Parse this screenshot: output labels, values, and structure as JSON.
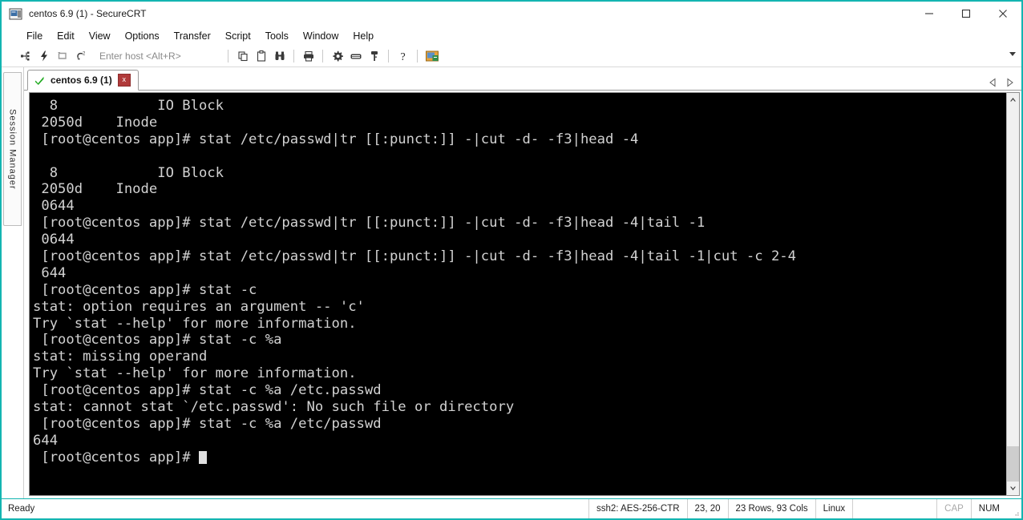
{
  "window": {
    "title": "centos 6.9 (1) - SecureCRT",
    "app_icon": "securecrt-terminal-icon",
    "controls": {
      "minimize": "minimize-icon",
      "maximize": "maximize-icon",
      "close": "close-icon"
    },
    "border_color": "#13b5b1"
  },
  "menu": {
    "items": [
      {
        "label": "File"
      },
      {
        "label": "Edit"
      },
      {
        "label": "View"
      },
      {
        "label": "Options"
      },
      {
        "label": "Transfer"
      },
      {
        "label": "Script"
      },
      {
        "label": "Tools"
      },
      {
        "label": "Window"
      },
      {
        "label": "Help"
      }
    ]
  },
  "toolbar": {
    "icons_left": [
      {
        "name": "connect-icon"
      },
      {
        "name": "quick-connect-lightning-icon"
      },
      {
        "name": "reconnect-icon"
      },
      {
        "name": "clone-session-icon"
      }
    ],
    "host_placeholder": "Enter host <Alt+R>",
    "icons_mid": [
      {
        "name": "copy-icon"
      },
      {
        "name": "paste-icon"
      },
      {
        "name": "find-binoculars-icon"
      }
    ],
    "icons_print": [
      {
        "name": "print-icon"
      }
    ],
    "icons_right": [
      {
        "name": "gear-settings-icon"
      },
      {
        "name": "keyboard-icon"
      },
      {
        "name": "key-icon"
      }
    ],
    "icons_help": [
      {
        "name": "help-question-icon"
      }
    ],
    "icons_session": [
      {
        "name": "session-options-icon"
      }
    ],
    "overflow": "toolbar-overflow-chevron"
  },
  "sidebar": {
    "session_manager_label": "Session Manager"
  },
  "tabstrip": {
    "tabs": [
      {
        "label": "centos 6.9 (1)",
        "status_icon": "green-check-icon",
        "close_label": "x",
        "active": true
      }
    ],
    "nav": {
      "prev": "tab-scroll-left-icon",
      "next": "tab-scroll-right-icon"
    }
  },
  "terminal": {
    "background": "#000000",
    "foreground": "#d2d2d2",
    "cursor": "block",
    "lines": [
      "  8            IO Block",
      " 2050d    Inode",
      " [root@centos app]# stat /etc/passwd|tr [[:punct:]] -|cut -d- -f3|head -4",
      "",
      "  8            IO Block",
      " 2050d    Inode",
      " 0644",
      " [root@centos app]# stat /etc/passwd|tr [[:punct:]] -|cut -d- -f3|head -4|tail -1",
      " 0644",
      " [root@centos app]# stat /etc/passwd|tr [[:punct:]] -|cut -d- -f3|head -4|tail -1|cut -c 2-4",
      " 644",
      " [root@centos app]# stat -c",
      "stat: option requires an argument -- 'c'",
      "Try `stat --help' for more information.",
      " [root@centos app]# stat -c %a",
      "stat: missing operand",
      "Try `stat --help' for more information.",
      " [root@centos app]# stat -c %a /etc.passwd",
      "stat: cannot stat `/etc.passwd': No such file or directory",
      " [root@centos app]# stat -c %a /etc/passwd",
      "644"
    ],
    "prompt_line": " [root@centos app]# "
  },
  "scrollbar": {
    "up_arrow": "scroll-up-icon",
    "down_arrow": "scroll-down-icon"
  },
  "statusbar": {
    "ready": "Ready",
    "encryption": "ssh2: AES-256-CTR",
    "cursor_pos": "23, 20",
    "dimensions": "23 Rows, 93 Cols",
    "terminal_type": "Linux",
    "caps": "CAP",
    "num": "NUM"
  }
}
